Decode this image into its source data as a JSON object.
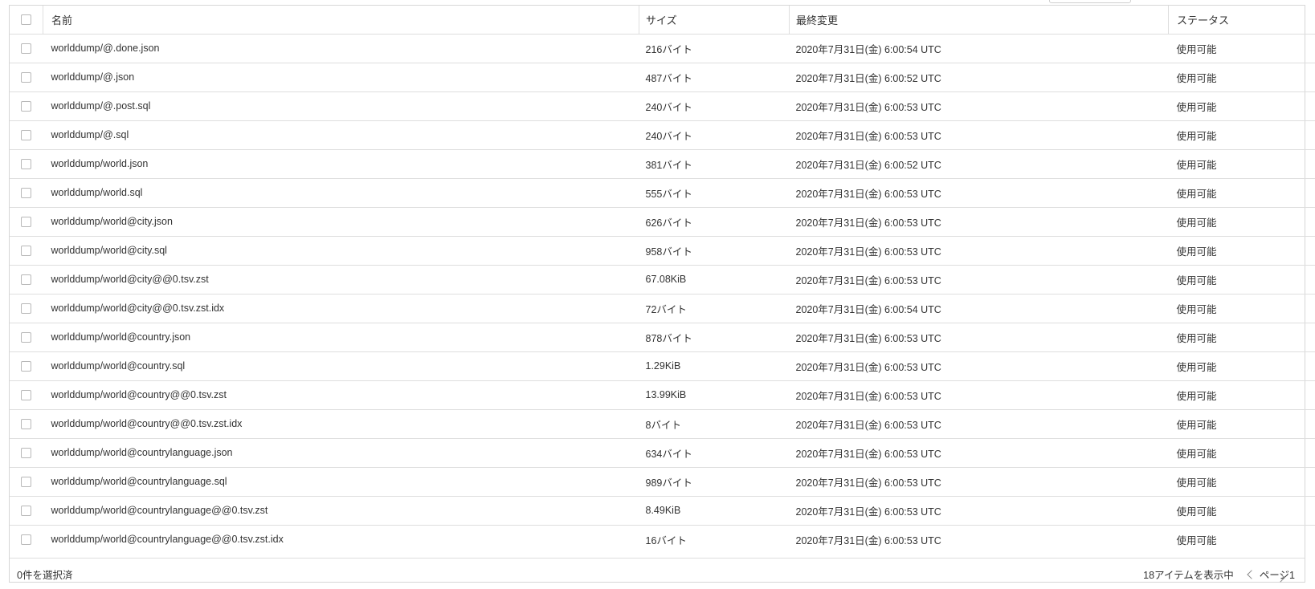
{
  "table": {
    "headers": {
      "name": "名前",
      "size": "サイズ",
      "modified": "最終変更",
      "status": "ステータス"
    },
    "rows": [
      {
        "name": "worlddump/@.done.json",
        "size": "216バイト",
        "modified": "2020年7月31日(金) 6:00:54 UTC",
        "status": "使用可能"
      },
      {
        "name": "worlddump/@.json",
        "size": "487バイト",
        "modified": "2020年7月31日(金) 6:00:52 UTC",
        "status": "使用可能"
      },
      {
        "name": "worlddump/@.post.sql",
        "size": "240バイト",
        "modified": "2020年7月31日(金) 6:00:53 UTC",
        "status": "使用可能"
      },
      {
        "name": "worlddump/@.sql",
        "size": "240バイト",
        "modified": "2020年7月31日(金) 6:00:53 UTC",
        "status": "使用可能"
      },
      {
        "name": "worlddump/world.json",
        "size": "381バイト",
        "modified": "2020年7月31日(金) 6:00:52 UTC",
        "status": "使用可能"
      },
      {
        "name": "worlddump/world.sql",
        "size": "555バイト",
        "modified": "2020年7月31日(金) 6:00:53 UTC",
        "status": "使用可能"
      },
      {
        "name": "worlddump/world@city.json",
        "size": "626バイト",
        "modified": "2020年7月31日(金) 6:00:53 UTC",
        "status": "使用可能"
      },
      {
        "name": "worlddump/world@city.sql",
        "size": "958バイト",
        "modified": "2020年7月31日(金) 6:00:53 UTC",
        "status": "使用可能"
      },
      {
        "name": "worlddump/world@city@@0.tsv.zst",
        "size": "67.08KiB",
        "modified": "2020年7月31日(金) 6:00:53 UTC",
        "status": "使用可能"
      },
      {
        "name": "worlddump/world@city@@0.tsv.zst.idx",
        "size": "72バイト",
        "modified": "2020年7月31日(金) 6:00:54 UTC",
        "status": "使用可能"
      },
      {
        "name": "worlddump/world@country.json",
        "size": "878バイト",
        "modified": "2020年7月31日(金) 6:00:53 UTC",
        "status": "使用可能"
      },
      {
        "name": "worlddump/world@country.sql",
        "size": "1.29KiB",
        "modified": "2020年7月31日(金) 6:00:53 UTC",
        "status": "使用可能"
      },
      {
        "name": "worlddump/world@country@@0.tsv.zst",
        "size": "13.99KiB",
        "modified": "2020年7月31日(金) 6:00:53 UTC",
        "status": "使用可能"
      },
      {
        "name": "worlddump/world@country@@0.tsv.zst.idx",
        "size": "8バイト",
        "modified": "2020年7月31日(金) 6:00:53 UTC",
        "status": "使用可能"
      },
      {
        "name": "worlddump/world@countrylanguage.json",
        "size": "634バイト",
        "modified": "2020年7月31日(金) 6:00:53 UTC",
        "status": "使用可能"
      },
      {
        "name": "worlddump/world@countrylanguage.sql",
        "size": "989バイト",
        "modified": "2020年7月31日(金) 6:00:53 UTC",
        "status": "使用可能"
      },
      {
        "name": "worlddump/world@countrylanguage@@0.tsv.zst",
        "size": "8.49KiB",
        "modified": "2020年7月31日(金) 6:00:53 UTC",
        "status": "使用可能"
      },
      {
        "name": "worlddump/world@countrylanguage@@0.tsv.zst.idx",
        "size": "16バイト",
        "modified": "2020年7月31日(金) 6:00:53 UTC",
        "status": "使用可能"
      }
    ]
  },
  "footer": {
    "selected_text": "0件を選択済",
    "items_text": "18アイテムを表示中",
    "page_text": "ページ1"
  },
  "icons": {
    "row_menu": "kebab-menu-icon",
    "prev": "chevron-left-icon",
    "next": "chevron-right-icon"
  }
}
